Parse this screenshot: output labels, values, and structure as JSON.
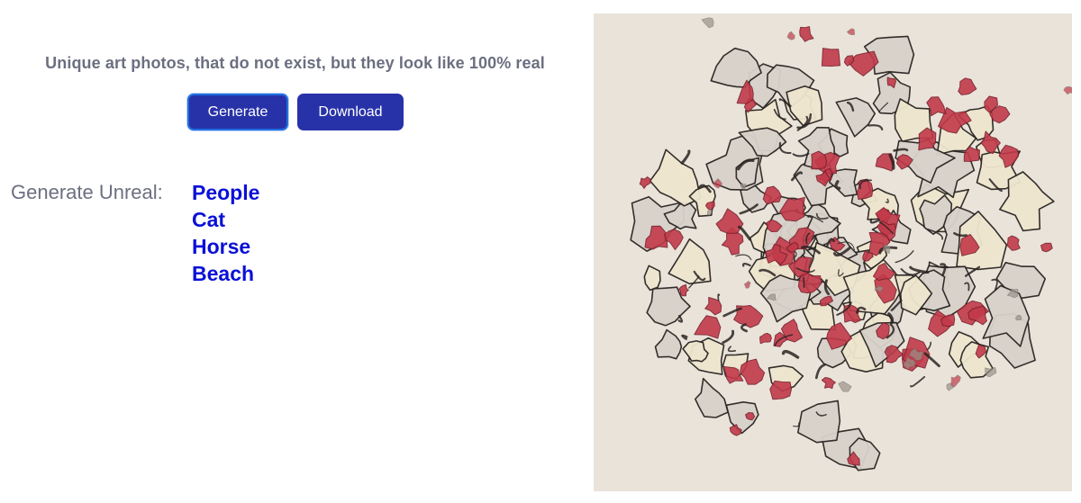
{
  "header": {
    "tagline": "Unique art photos, that do not exist, but they look like 100% real"
  },
  "actions": {
    "generate_label": "Generate",
    "download_label": "Download"
  },
  "categories": {
    "label": "Generate Unreal:",
    "items": [
      "People",
      "Cat",
      "Horse",
      "Beach"
    ]
  },
  "artwork": {
    "kind": "generated-abstract-painting",
    "colors": {
      "background": "#e9e3da",
      "ink": "#2a2522",
      "red": "#c23a4a",
      "cream": "#efe6cf"
    }
  },
  "colors": {
    "button": "#2832a8",
    "link": "#0a10d6",
    "muted_text": "#6b6f80"
  }
}
